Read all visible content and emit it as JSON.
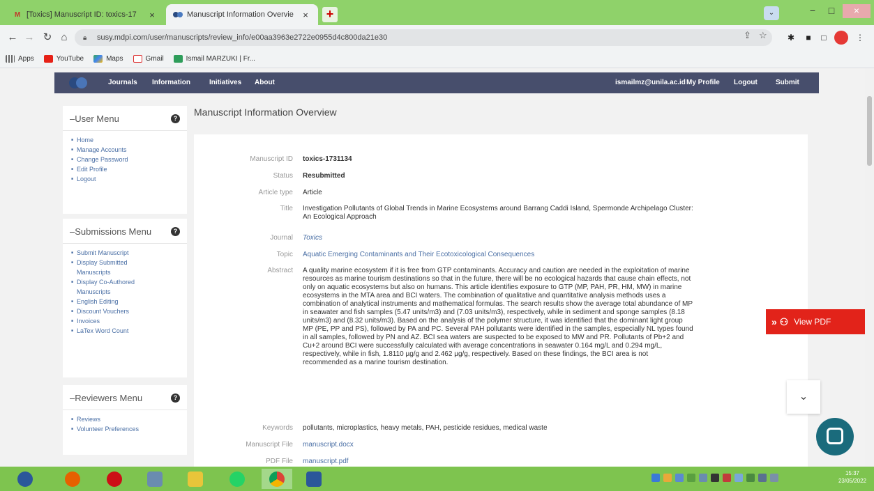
{
  "browser": {
    "tabs": [
      {
        "title": "[Toxics] Manuscript ID: toxics-17",
        "close": "×"
      },
      {
        "title": "Manuscript Information Overvie",
        "close": "×"
      }
    ],
    "new_tab": "+",
    "url": "susy.mdpi.com/user/manuscripts/review_info/e00aa3963e2722e0955d4c800da21e30",
    "bookmarks": [
      "Apps",
      "YouTube",
      "Maps",
      "Gmail",
      "Ismail MARZUKI | Fr..."
    ],
    "window": {
      "minimize": "−",
      "maximize": "□",
      "close": "×"
    }
  },
  "sitenav": {
    "items": [
      "Journals",
      "Information",
      "Initiatives",
      "About",
      "ismailmz@unila.ac.id",
      "My Profile",
      "Logout",
      "Submit"
    ]
  },
  "sidebar": {
    "user_menu": {
      "title": "User Menu",
      "items": [
        "Home",
        "Manage Accounts",
        "Change Password",
        "Edit Profile",
        "Logout"
      ]
    },
    "submissions_menu": {
      "title": "Submissions Menu",
      "items": [
        "Submit Manuscript",
        "Display Submitted Manuscripts",
        "Display Co-Authored Manuscripts",
        "English Editing",
        "Discount Vouchers",
        "Invoices",
        "LaTex Word Count"
      ]
    },
    "reviewers_menu": {
      "title": "Reviewers Menu",
      "items": [
        "Reviews",
        "Volunteer Preferences"
      ]
    }
  },
  "main": {
    "heading": "Manuscript Information Overview",
    "fields": {
      "manuscript_id": {
        "label": "Manuscript ID",
        "value": "toxics-1731134"
      },
      "status": {
        "label": "Status",
        "value": "Resubmitted"
      },
      "article_type": {
        "label": "Article type",
        "value": "Article"
      },
      "title": {
        "label": "Title",
        "value": "Investigation Pollutants of Global Trends in Marine Ecosystems around Barrang Caddi Island, Spermonde Archipelago Cluster: An Ecological Approach"
      },
      "journal": {
        "label": "Journal",
        "value": "Toxics"
      },
      "topic": {
        "label": "Topic",
        "value": "Aquatic Emerging Contaminants and Their Ecotoxicological Consequences"
      },
      "abstract": {
        "label": "Abstract",
        "value": "A quality marine ecosystem if it is free from GTP contaminants. Accuracy and caution are needed in the exploitation of marine resources as marine tourism destinations so that in the future, there will be no ecological hazards that cause chain effects, not only on aquatic ecosystems but also on humans. This article identifies exposure to GTP (MP, PAH, PR, HM, MW) in marine ecosystems in the MTA area and BCI waters. The combination of qualitative and quantitative analysis methods uses a combination of analytical instruments and mathematical formulas. The search results show the average total abundance of MP in seawater and fish samples (5.47 units/m3) and (7.03 units/m3), respectively, while in sediment and sponge samples (8.18 units/m3) and (8.32 units/m3). Based on the analysis of the polymer structure, it was identified that the dominant light group MP (PE, PP and PS), followed by PA and PC. Several PAH pollutants were identified in the samples, especially NL types found in all samples, followed by PN and AZ. BCI sea waters are suspected to be exposed to MW and PR. Pollutants of Pb+2 and Cu+2 around BCI were successfully calculated with average concentrations in seawater 0.164 mg/L and 0.294 mg/L, respectively, while in fish, 1.8110 µg/g and 2.462 µg/g, respectively. Based on these findings, the BCI area is not recommended as a marine tourism destination."
      },
      "keywords": {
        "label": "Keywords",
        "value": "pollutants, microplastics, heavy metals, PAH, pesticide residues, medical waste"
      },
      "manuscript_file": {
        "label": "Manuscript File",
        "value": "manuscript.docx"
      },
      "pdf_file": {
        "label": "PDF File",
        "value": "manuscript.pdf"
      }
    }
  },
  "floating": {
    "view_pdf": "View PDF"
  },
  "taskbar": {
    "clock_time": "15:37",
    "clock_date": "23/05/2022"
  },
  "colors": {
    "site_nav": "#474e6c",
    "link": "#4a6fa5",
    "view_pdf": "#e2231a",
    "tab_strip": "#8fd26a",
    "taskbar": "#7ec44f",
    "chat": "#1a6b7c"
  }
}
